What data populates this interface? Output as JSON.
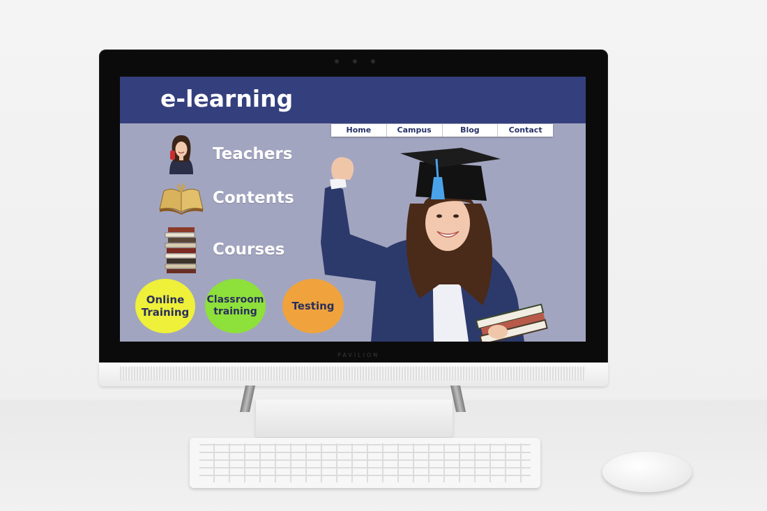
{
  "site": {
    "title": "e-learning"
  },
  "nav": {
    "items": [
      "Home",
      "Campus",
      "Blog",
      "Contact"
    ]
  },
  "menu": {
    "items": [
      {
        "label": "Teachers",
        "icon": "woman-on-phone-icon"
      },
      {
        "label": "Contents",
        "icon": "open-book-icon"
      },
      {
        "label": "Courses",
        "icon": "book-stack-icon"
      }
    ]
  },
  "training": {
    "online": {
      "line1": "Online",
      "line2": "Training",
      "color": "#eef03a"
    },
    "classroom": {
      "line1": "Classroom",
      "line2": "training",
      "color": "#8ee03a"
    },
    "testing": {
      "label": "Testing",
      "color": "#f0a33c"
    }
  },
  "hardware": {
    "brand": "PAVILION"
  },
  "colors": {
    "header": "#34407d",
    "screen_bg": "#a2a5c0",
    "nav_text": "#253066"
  }
}
